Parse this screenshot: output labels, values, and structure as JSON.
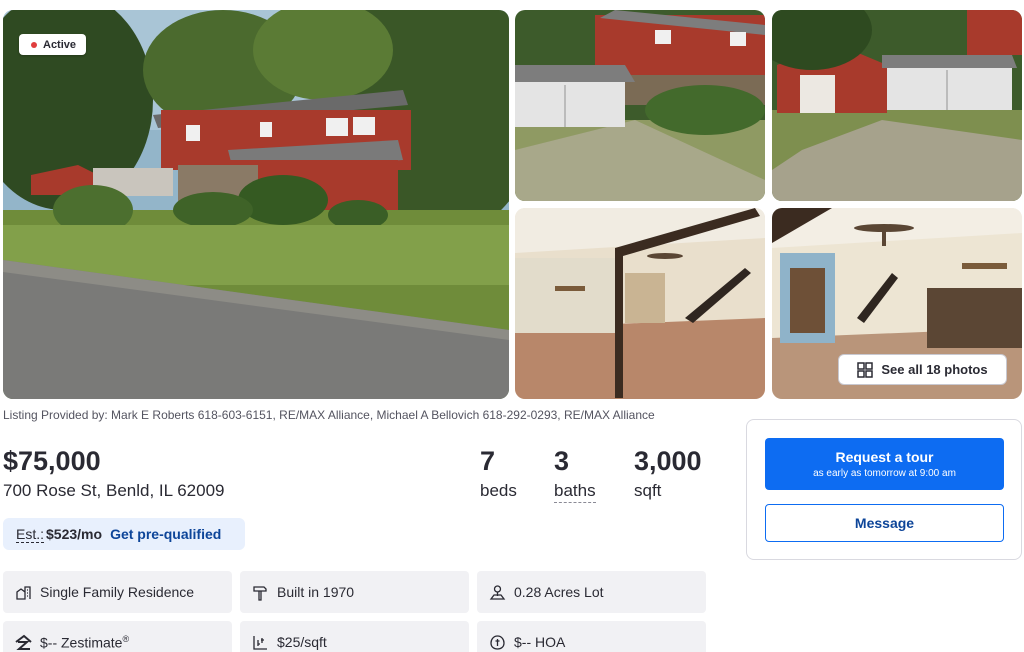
{
  "listing": {
    "status": "Active",
    "see_all_photos": "See all 18 photos",
    "provided_by": "Listing Provided by: Mark E Roberts 618-603-6151, RE/MAX Alliance, Michael A Bellovich 618-292-0293, RE/MAX Alliance",
    "price": "$75,000",
    "address": "700 Rose St, Benld, IL 62009",
    "stats": {
      "beds_value": "7",
      "beds_label": "beds",
      "baths_value": "3",
      "baths_label": "baths",
      "sqft_value": "3,000",
      "sqft_label": "sqft"
    },
    "estimate": {
      "prefix": "Est.:",
      "amount": "$523/mo",
      "prequal_link": "Get pre-qualified"
    }
  },
  "facts": [
    {
      "icon": "house-type-icon",
      "text": "Single Family Residence"
    },
    {
      "icon": "hammer-icon",
      "text": "Built in 1970"
    },
    {
      "icon": "lot-size-icon",
      "text": "0.28 Acres Lot"
    },
    {
      "icon": "zestimate-icon",
      "text": "$-- Zestimate",
      "sup": "®"
    },
    {
      "icon": "price-per-sqft-icon",
      "text": "$25/sqft"
    },
    {
      "icon": "hoa-icon",
      "text": "$-- HOA"
    }
  ],
  "cta": {
    "tour_label": "Request a tour",
    "tour_sub": "as early as tomorrow at 9:00 am",
    "message_label": "Message"
  },
  "colors": {
    "primary": "#0d6cf2",
    "link": "#0d4599",
    "status_dot": "#e03e3e",
    "pill_bg": "#e8f0fd"
  }
}
